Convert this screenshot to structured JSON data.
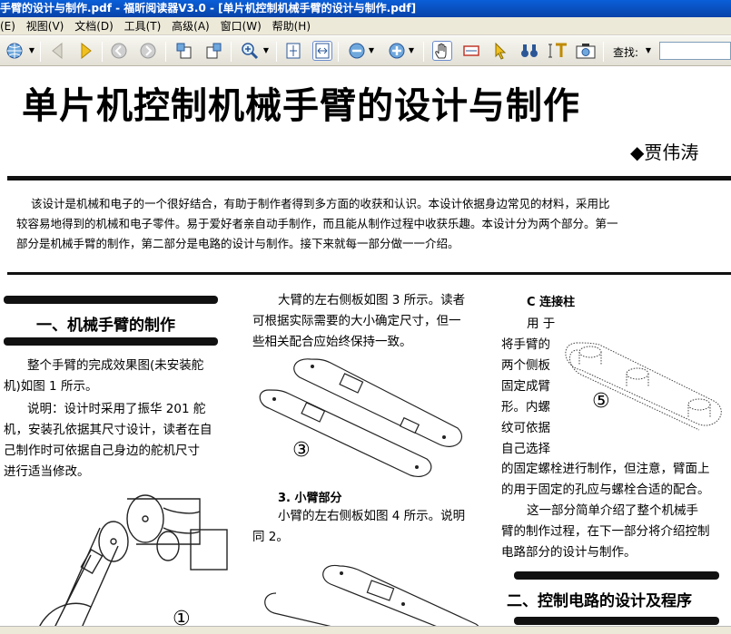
{
  "window": {
    "title": "手臂的设计与制作.pdf - 福昕阅读器V3.0 - [单片机控制机械手臂的设计与制作.pdf]"
  },
  "menu": {
    "items": [
      "(E)",
      "视图(V)",
      "文档(D)",
      "工具(T)",
      "高级(A)",
      "窗口(W)",
      "帮助(H)"
    ]
  },
  "toolbar": {
    "find_label": "查找:",
    "find_value": ""
  },
  "icons": [
    "globe-icon",
    "prev-page-icon",
    "next-page-icon",
    "back-icon",
    "forward-icon",
    "rotate-ccw-icon",
    "rotate-cw-icon",
    "zoom-in-icon",
    "fit-page-icon",
    "fit-width-icon",
    "zoom-out-minus-icon",
    "zoom-in-plus-icon",
    "hand-tool-icon",
    "snapshot-icon",
    "select-arrow-icon",
    "binoculars-icon",
    "text-select-icon",
    "camera-icon"
  ],
  "document": {
    "title": "单片机控制机械手臂的设计与制作",
    "author": "◆贾伟涛",
    "abstract_lines": [
      "该设计是机械和电子的一个很好结合，有助于制作者得到多方面的收获和认识。本设计依据身边常见的材料，采用比",
      "较容易地得到的机械和电子零件。易于爱好者亲自动手制作，而且能从制作过程中收获乐趣。本设计分为两个部分。第一",
      "部分是机械手臂的制作，第二部分是电路的设计与制作。接下来就每一部分做一一介绍。"
    ],
    "sec1_title": "一、机械手臂的制作",
    "col1_p1": [
      "整个手臂的完成效果图(未安装舵",
      "机)如图 1 所示。"
    ],
    "col1_p2": [
      "说明：设计时采用了振华 201 舵",
      "机，安装孔依据其尺寸设计，读者在自",
      "己制作时可依据自己身边的舵机尺寸",
      "进行适当修改。"
    ],
    "col2_p1": [
      "大臂的左右侧板如图 3 所示。读者",
      "可根据实际需要的大小确定尺寸，但一",
      "些相关配合应始终保持一致。"
    ],
    "col2_head": "3.  小臂部分",
    "col2_p2": [
      "小臂的左右侧板如图 4 所示。说明",
      "同 2。"
    ],
    "col3_head": "C 连接柱",
    "col3_p1": [
      "用 于",
      "将手臂的",
      "两个侧板",
      "固定成臂",
      "形。内螺",
      "纹可依据",
      "自己选择"
    ],
    "col3_p2": [
      "的固定螺栓进行制作，但注意，臂面上",
      "的用于固定的孔应与螺栓合适的配合。"
    ],
    "col3_p3": [
      "这一部分简单介绍了整个机械手",
      "臂的制作过程，在下一部分将介绍控制",
      "电路部分的设计与制作。"
    ],
    "sec2_title": "二、控制电路的设计及程序",
    "fig_labels": {
      "fig1": "①",
      "fig3": "③",
      "fig5": "⑤"
    }
  }
}
